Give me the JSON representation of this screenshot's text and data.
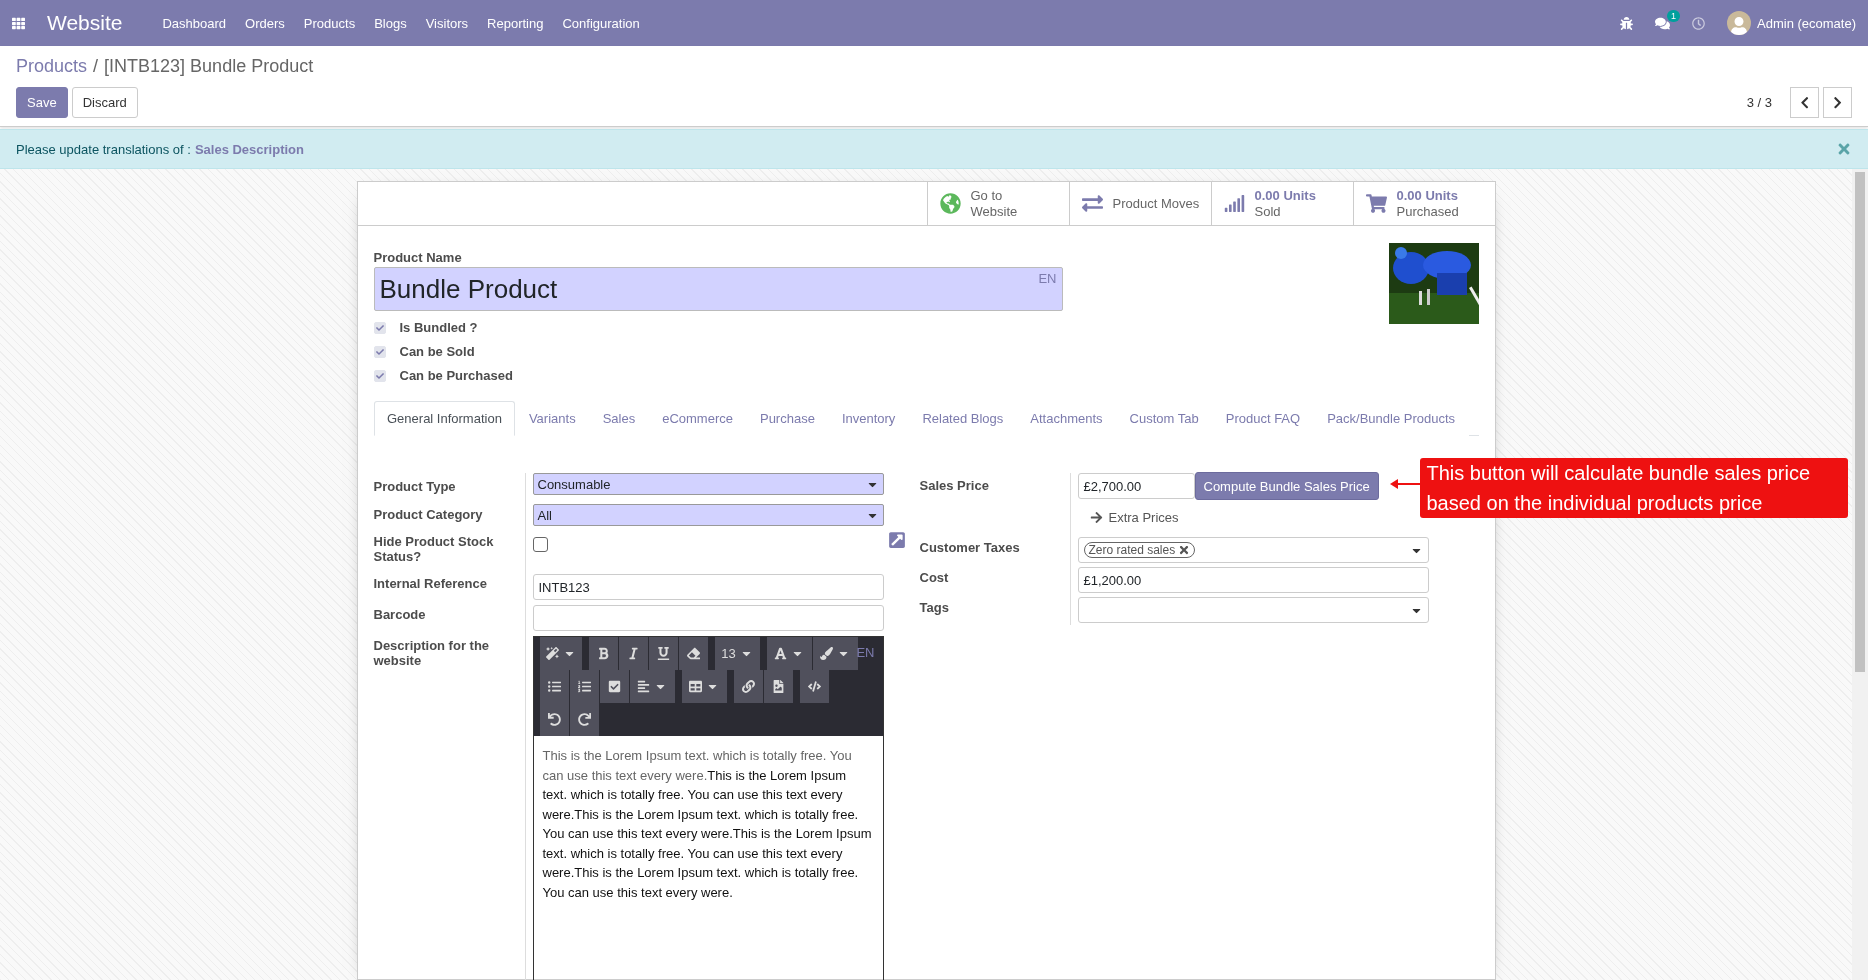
{
  "navbar": {
    "app": "Website",
    "menu": [
      {
        "label": "Dashboard"
      },
      {
        "label": "Orders"
      },
      {
        "label": "Products"
      },
      {
        "label": "Blogs"
      },
      {
        "label": "Visitors"
      },
      {
        "label": "Reporting"
      },
      {
        "label": "Configuration"
      }
    ],
    "chat_count": "1",
    "user": "Admin (ecomate)"
  },
  "breadcrumb": {
    "parent": "Products",
    "separator": "/",
    "current": "[INTB123] Bundle Product"
  },
  "buttons": [
    {
      "label": "Save",
      "kind": "primary"
    },
    {
      "label": "Discard",
      "kind": "secondary"
    }
  ],
  "pager": "3 / 3",
  "alert": {
    "text": "Please update translations of :",
    "link": "Sales Description"
  },
  "smart_buttons": [
    {
      "kind": "website",
      "lines": [
        "Go to",
        "Website"
      ]
    },
    {
      "kind": "moves",
      "lines": [
        "Product Moves"
      ]
    },
    {
      "kind": "sold",
      "value": "0.00 Units",
      "lines": [
        "Sold"
      ]
    },
    {
      "kind": "purchased",
      "value": "0.00 Units",
      "lines": [
        "Purchased"
      ]
    }
  ],
  "product_name": {
    "label": "Product Name",
    "value": "Bundle Product",
    "lang": "EN"
  },
  "flags": [
    {
      "label": "Is Bundled ?",
      "checked": true
    },
    {
      "label": "Can be Sold",
      "checked": true
    },
    {
      "label": "Can be Purchased",
      "checked": true
    }
  ],
  "tabs": [
    {
      "label": "General Information",
      "selected": true
    },
    {
      "label": "Variants",
      "selected": false
    },
    {
      "label": "Sales",
      "selected": false
    },
    {
      "label": "eCommerce",
      "selected": false
    },
    {
      "label": "Purchase",
      "selected": false
    },
    {
      "label": "Inventory",
      "selected": false
    },
    {
      "label": "Related Blogs",
      "selected": false
    },
    {
      "label": "Attachments",
      "selected": false
    },
    {
      "label": "Custom Tab",
      "selected": false
    },
    {
      "label": "Product FAQ",
      "selected": false
    },
    {
      "label": "Pack/Bundle Products",
      "selected": false
    }
  ],
  "left_fields": [
    {
      "label": "Product Type",
      "kind": "select",
      "value": "Consumable"
    },
    {
      "label": "Product Category",
      "kind": "many2one",
      "value": "All"
    },
    {
      "label": "Hide Product Stock Status?",
      "kind": "checkbox",
      "checked": false
    },
    {
      "label": "Internal Reference",
      "kind": "text",
      "value": "INTB123"
    },
    {
      "label": "Barcode",
      "kind": "text"
    },
    {
      "label": "Description for the website",
      "kind": "html",
      "lang": "EN",
      "font_size": "13",
      "muted_text": "This is the Lorem Ipsum text. which is totally free. You can use this text every were.",
      "text": "This is the Lorem Ipsum text. which is totally free. You can use this text every were.This is the Lorem Ipsum text. which is totally free. You can use this text every were.This is the Lorem Ipsum text. which is totally free. You can use this text every were.This is the Lorem Ipsum text. which is totally free. You can use this text every were."
    }
  ],
  "right_fields": [
    {
      "label": "Sales Price",
      "kind": "price",
      "value": "£2,700.00",
      "button": "Compute Bundle Sales Price",
      "link": "Extra Prices"
    },
    {
      "label": "Customer Taxes",
      "kind": "tags",
      "tags": [
        "Zero rated sales"
      ]
    },
    {
      "label": "Cost",
      "kind": "text",
      "value": "£1,200.00"
    },
    {
      "label": "Tags",
      "kind": "tags"
    }
  ],
  "annotation": {
    "lines": [
      "This button will calculate bundle sales price",
      "based on the individual products price"
    ]
  }
}
